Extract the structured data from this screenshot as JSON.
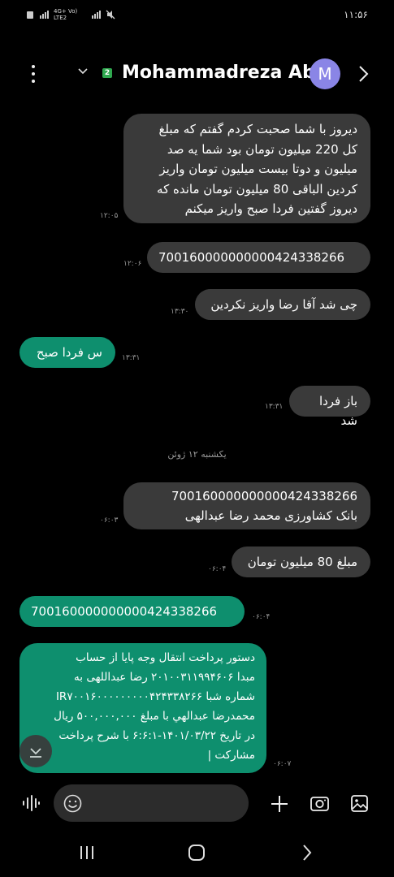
{
  "status_bar": {
    "network": "4G+ Vo) LTE2",
    "time": "۱۱:۵۶"
  },
  "header": {
    "contact_name": "Mohammadreza Ab",
    "avatar_letter": "M",
    "sim_number": "2"
  },
  "messages": [
    {
      "dir": "in",
      "text": "دیروز با شما صحبت کردم گفتم که مبلغ\nکل 220 میلیون تومان بود شما یه صد\nمیلیون و دوتا بیست میلیون تومان واریز\nکردین الباقی 80 میلیون تومان مانده که\nدیروز گفتین فردا صبح واریز میکنم",
      "time": "۱۲:۰۵"
    },
    {
      "dir": "in",
      "text": "700160000000000424338266",
      "time": "۱۲:۰۶"
    },
    {
      "dir": "in",
      "text": "چی شد آقا رضا واریز نکردین",
      "time": "۱۳:۳۰"
    },
    {
      "dir": "out",
      "text": "س فردا صبح",
      "time": "۱۳:۳۱"
    },
    {
      "dir": "in",
      "text": "باز فردا شد",
      "time": "۱۳:۳۱"
    },
    {
      "dir": "in",
      "text": "700160000000000424338266\nبانک کشاورزی محمد رضا عبدالهی",
      "time": "۰۶:۰۳"
    },
    {
      "dir": "in",
      "text": "مبلغ 80 میلیون تومان",
      "time": "۰۶:۰۴"
    },
    {
      "dir": "out",
      "text": "700160000000000424338266",
      "time": "۰۶:۰۴"
    },
    {
      "dir": "out",
      "text": "دستور پرداخت انتقال وجه پایا از حساب\nمبدا ۲۰۱۰۰۳۱۱۹۹۴۶۰۶ رضا عبداللهی به\nشماره شبا IR۷۰۰۱۶۰۰۰۰۰۰۰۰۰۴۲۴۳۳۸۲۶۶\nمحمدرضا عبدالهي   با مبلغ ۵۰۰,۰۰۰,۰۰۰ ریال\nدر تاریخ ۱۴۰۱/۰۳/۲۲-۶:۶:۱ با شرح پرداخت\nمشارکت  |",
      "time": "۰۶:۰۷"
    }
  ],
  "date_separator": "یکشنبه ۱۲ ژوئن",
  "input": {
    "placeholder": ""
  },
  "colors": {
    "incoming": "#3a3a3a",
    "outgoing": "#0e8f6e",
    "avatar": "#8a85e6"
  }
}
